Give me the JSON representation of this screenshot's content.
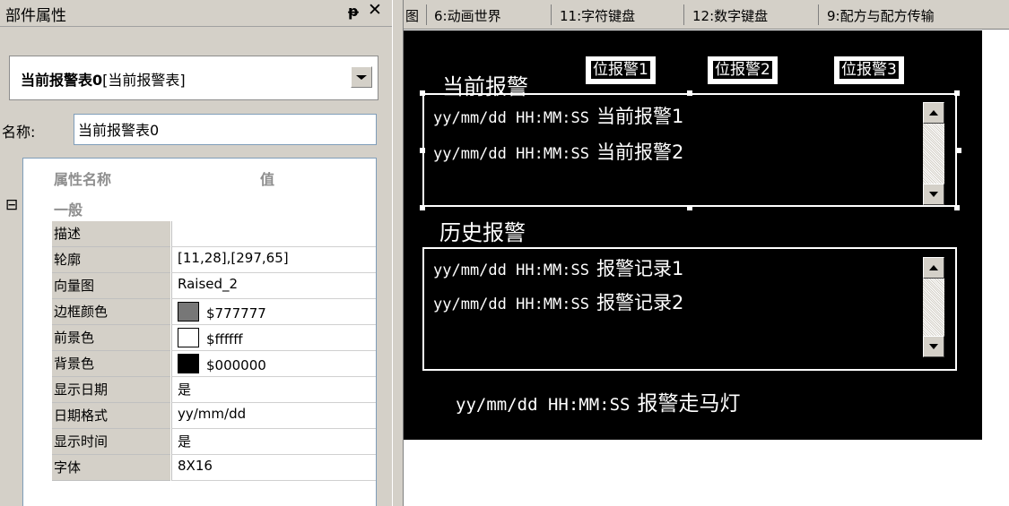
{
  "panel": {
    "title": "部件属性",
    "pin_glyph": "ᵽ",
    "close_glyph": "✕",
    "object_select": {
      "name_bold": "当前报警表0",
      "type": "[当前报警表]"
    },
    "name_label": "名称:",
    "name_value": "当前报警表0",
    "grid": {
      "col_name": "属性名称",
      "col_value": "值",
      "group_toggle": "⊟",
      "group": "一般",
      "rows": [
        {
          "name": "描述",
          "value": ""
        },
        {
          "name": "轮廓",
          "value": "[11,28],[297,65]"
        },
        {
          "name": "向量图",
          "value": "Raised_2"
        },
        {
          "name": "边框颜色",
          "value": "$777777",
          "swatch": "#777777"
        },
        {
          "name": "前景色",
          "value": "$ffffff",
          "swatch": "#ffffff"
        },
        {
          "name": "背景色",
          "value": "$000000",
          "swatch": "#000000"
        },
        {
          "name": "显示日期",
          "value": "是"
        },
        {
          "name": "日期格式",
          "value": "yy/mm/dd"
        },
        {
          "name": "显示时间",
          "value": "是"
        },
        {
          "name": "字体",
          "value": "8X16"
        }
      ]
    }
  },
  "tabs": [
    "图",
    "6:动画世界",
    "11:字符键盘",
    "12:数字键盘",
    "9:配方与配方传输"
  ],
  "canvas": {
    "current_alarm_title": "当前报警",
    "filter_buttons": [
      "位报警1",
      "位报警2",
      "位报警3"
    ],
    "current_alarms": [
      {
        "time": "yy/mm/dd  HH:MM:SS",
        "text": "当前报警1"
      },
      {
        "time": "yy/mm/dd  HH:MM:SS",
        "text": "当前报警2"
      }
    ],
    "history_title": "历史报警",
    "history_alarms": [
      {
        "time": "yy/mm/dd HH:MM:SS",
        "text": "报警记录1"
      },
      {
        "time": "yy/mm/dd HH:MM:SS",
        "text": "报警记录2"
      }
    ],
    "marquee": {
      "time": "yy/mm/dd HH:MM:SS",
      "text": "报警走马灯"
    }
  },
  "colors": {
    "canvas_bg": "#000000",
    "panel_bg": "#d4d0c8",
    "grid_border": "#7f9db9"
  }
}
